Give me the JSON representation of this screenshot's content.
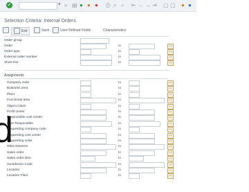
{
  "window": {
    "command_field_value": ""
  },
  "title": "Selection Criteria: Internal Orders",
  "app_toolbar": {
    "exec_label": "Exit",
    "save_label": "Save",
    "user_defined_label": "User-Defined Fields",
    "characteristics_label": "Characteristics"
  },
  "top_fields": [
    {
      "label": "Order group",
      "has_to": false
    },
    {
      "label": "Order",
      "has_to": true,
      "to_label": "to"
    },
    {
      "label": "Order type",
      "has_to": true,
      "to_label": "to"
    },
    {
      "label": "External order number",
      "has_to": true,
      "to_label": "to"
    },
    {
      "label": "Short text",
      "has_to": true,
      "to_label": "to"
    }
  ],
  "assignments": {
    "title": "Assignments",
    "fields": [
      {
        "label": "Company code",
        "to_label": "to"
      },
      {
        "label": "Business area",
        "to_label": "to"
      },
      {
        "label": "Plant",
        "to_label": "to"
      },
      {
        "label": "Functional area",
        "to_label": "to"
      },
      {
        "label": "Object Class",
        "to_label": "to"
      },
      {
        "label": "Profit center",
        "to_label": "to"
      },
      {
        "label": "Responsible cost center",
        "to_label": "to"
      },
      {
        "label": "User Responsible",
        "to_label": "to"
      },
      {
        "label": "Requesting company code",
        "to_label": "to"
      },
      {
        "label": "Requesting cost center",
        "to_label": "to"
      },
      {
        "label": "Requesting order",
        "to_label": "to"
      },
      {
        "label": "WBS Element",
        "to_label": "to"
      },
      {
        "label": "Sales order",
        "to_label": "to"
      },
      {
        "label": "Sales order item",
        "to_label": "to"
      },
      {
        "label": "Jurisdiction Code",
        "to_label": "to"
      },
      {
        "label": "Location",
        "to_label": "to"
      },
      {
        "label": "Location Plant",
        "to_label": "to"
      }
    ]
  },
  "stray_text": "d"
}
